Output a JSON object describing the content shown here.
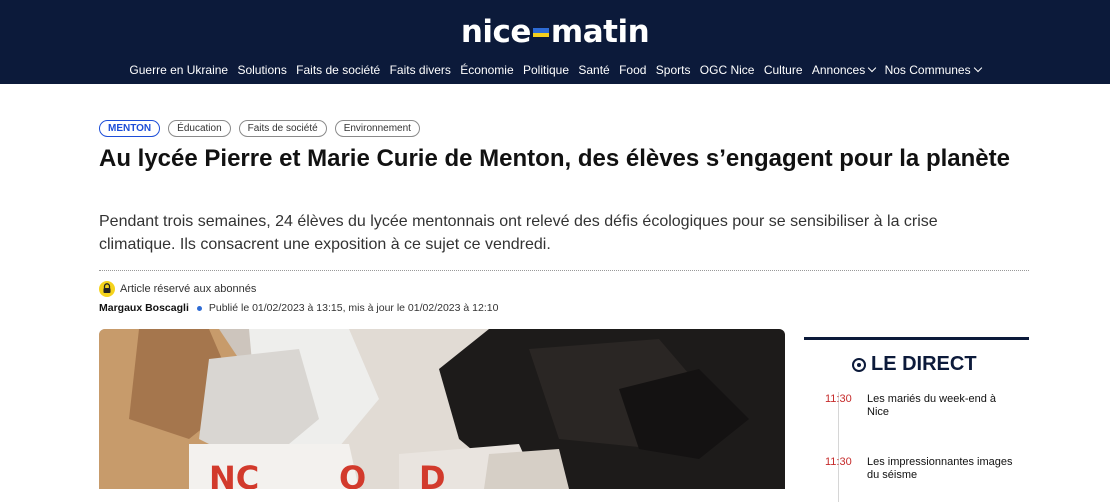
{
  "header": {
    "logo_left": "nice",
    "logo_right": "matin",
    "nav": [
      {
        "label": "Guerre en Ukraine"
      },
      {
        "label": "Solutions"
      },
      {
        "label": "Faits de société"
      },
      {
        "label": "Faits divers"
      },
      {
        "label": "Économie"
      },
      {
        "label": "Politique"
      },
      {
        "label": "Santé"
      },
      {
        "label": "Food"
      },
      {
        "label": "Sports"
      },
      {
        "label": "OGC Nice"
      },
      {
        "label": "Culture"
      },
      {
        "label": "Annonces",
        "dropdown": true
      },
      {
        "label": "Nos Communes",
        "dropdown": true
      }
    ]
  },
  "article": {
    "tags": [
      "MENTON",
      "Éducation",
      "Faits de société",
      "Environnement"
    ],
    "title": "Au lycée Pierre et Marie Curie de Menton, des élèves s’engagent pour la planète",
    "lead": "Pendant trois semaines, 24 élèves du lycée mentonnais ont relevé des défis écologiques pour se sensibiliser à la crise climatique. Ils consacrent une exposition à ce sujet ce vendredi.",
    "premium_label": "Article réservé aux abonnés",
    "author": "Margaux Boscagli",
    "published": "Publié le 01/02/2023 à 13:15, mis à jour le 01/02/2023 à 12:10"
  },
  "sidebar": {
    "title": "LE DIRECT",
    "items": [
      {
        "time": "11:30",
        "text": "Les mariés du week-end à Nice"
      },
      {
        "time": "11:30",
        "text": "Les impressionnantes images du séisme"
      }
    ]
  },
  "colors": {
    "header_bg": "#0c1a3a",
    "tag_primary": "#1d4ed8",
    "live_time": "#c62b2b",
    "flag_blue": "#2e6bd4",
    "flag_yellow": "#f5cf1c"
  }
}
